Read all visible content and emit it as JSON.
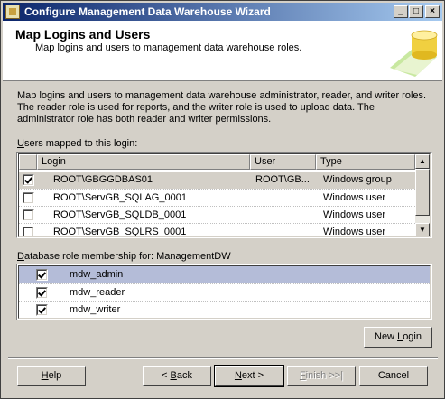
{
  "window": {
    "title": "Configure Management Data Warehouse Wizard",
    "controls": {
      "minimize": "_",
      "maximize": "□",
      "close": "×"
    }
  },
  "header": {
    "title": "Map Logins and Users",
    "subtitle": "Map logins and users to management data warehouse roles."
  },
  "description": "Map logins and users to management data warehouse administrator, reader, and writer roles. The reader role is used for reports, and the writer role is used to upload data. The administrator role has both reader and writer permissions.",
  "users_section": {
    "label_prefix": "",
    "label_accel": "U",
    "label_rest": "sers mapped to this login:",
    "columns": [
      "",
      "Login",
      "User",
      "Type"
    ],
    "rows": [
      {
        "checked": true,
        "login": "ROOT\\GBGGDBAS01",
        "user": "ROOT\\GB...",
        "type": "Windows group"
      },
      {
        "checked": false,
        "login": "ROOT\\ServGB_SQLAG_0001",
        "user": "",
        "type": "Windows user"
      },
      {
        "checked": false,
        "login": "ROOT\\ServGB_SQLDB_0001",
        "user": "",
        "type": "Windows user"
      },
      {
        "checked": false,
        "login": "ROOT\\ServGB_SQLRS_0001",
        "user": "",
        "type": "Windows user"
      }
    ]
  },
  "roles_section": {
    "label_prefix": "",
    "label_accel": "D",
    "label_rest": "atabase role membership for: ManagementDW",
    "rows": [
      {
        "checked": true,
        "role": "mdw_admin"
      },
      {
        "checked": true,
        "role": "mdw_reader"
      },
      {
        "checked": true,
        "role": "mdw_writer"
      }
    ]
  },
  "buttons": {
    "new_login": {
      "pre": "New ",
      "accel": "L",
      "post": "ogin"
    },
    "help": "Help",
    "back": {
      "pre": "< ",
      "accel": "B",
      "post": "ack"
    },
    "next": {
      "pre": "",
      "accel": "N",
      "post": "ext >"
    },
    "finish": {
      "pre": "",
      "accel": "F",
      "post": "inish >>|"
    },
    "cancel": "Cancel"
  },
  "colors": {
    "title_gradient_start": "#0a246a",
    "title_gradient_end": "#a6caf0",
    "face": "#d4d0c8",
    "selected_row": "#d4d0c8",
    "highlight_row": "#b4bcd8"
  }
}
